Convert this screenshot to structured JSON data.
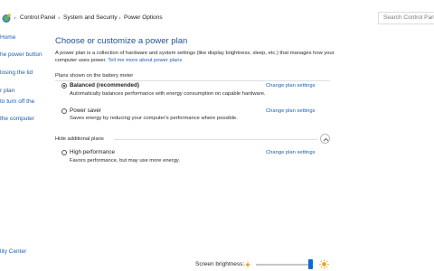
{
  "address_bar": {
    "crumbs": [
      "Control Panel",
      "System and Security",
      "Power Options"
    ],
    "search_placeholder": "Search Control Panel"
  },
  "sidebar": {
    "items": [
      "Home",
      "he power button",
      "losing the lid",
      "r plan",
      "to turn off the",
      "the computer"
    ],
    "bottom_link": "lity Center"
  },
  "main": {
    "title": "Choose or customize a power plan",
    "intro_text": "A power plan is a collection of hardware and system settings (like display brightness, sleep, etc.) that manages how your computer uses power.",
    "intro_link": "Tell me more about power plans",
    "section_label": "Plans shown on the battery meter",
    "hidden_label": "Hide additional plans",
    "change_link": "Change plan settings",
    "plans": [
      {
        "name": "Balanced (recommended)",
        "description": "Automatically balances performance with energy consumption on capable hardware.",
        "selected": true
      },
      {
        "name": "Power saver",
        "description": "Saves energy by reducing your computer's performance where possible.",
        "selected": false
      },
      {
        "name": "High performance",
        "description": "Favors performance, but may use more energy.",
        "selected": false
      }
    ]
  },
  "bottom": {
    "brightness_label": "Screen brightness:",
    "brightness_level": 0.97
  },
  "colors": {
    "link": "#1a5fb4",
    "title": "#1f4e9e",
    "slider_thumb": "#0a6bd8"
  },
  "icons": [
    "control-panel-icon",
    "chevron-up-icon",
    "sun-small-icon",
    "sun-large-icon"
  ]
}
